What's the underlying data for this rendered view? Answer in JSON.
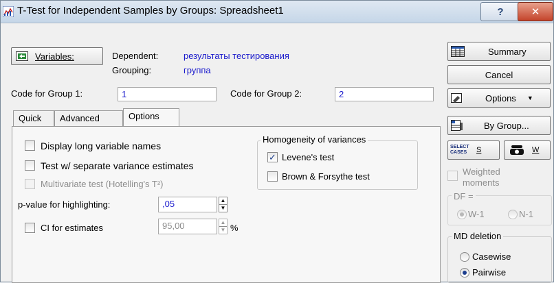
{
  "window": {
    "title": "T-Test for Independent Samples by Groups: Spreadsheet1"
  },
  "titlebar": {
    "help_glyph": "?",
    "close_glyph": "✕"
  },
  "variables": {
    "button_label": "Variables:",
    "dependent_label": "Dependent:",
    "dependent_value": "результаты тестирования",
    "grouping_label": "Grouping:",
    "grouping_value": "группа"
  },
  "codes": {
    "group1_label": "Code for Group 1:",
    "group1_value": "1",
    "group2_label": "Code for Group 2:",
    "group2_value": "2"
  },
  "tabs": [
    {
      "label": "Quick",
      "active": false
    },
    {
      "label": "Advanced",
      "active": false
    },
    {
      "label": "Options",
      "active": true
    }
  ],
  "options": {
    "long_names": {
      "label": "Display long variable names",
      "checked": false
    },
    "separate_variance": {
      "label": "Test w/ separate variance estimates",
      "checked": false
    },
    "multivariate": {
      "label": "Multivariate test (Hotelling's T²)",
      "checked": false,
      "disabled": true
    },
    "pvalue_label": "p-value for highlighting:",
    "pvalue_value": ",05",
    "ci": {
      "label": "CI for estimates",
      "checked": false,
      "value": "95,00",
      "unit": "%"
    },
    "homogeneity": {
      "title": "Homogeneity of variances",
      "levene": {
        "label": "Levene's test",
        "checked": true
      },
      "brown_forsythe": {
        "label": "Brown & Forsythe test",
        "checked": false
      }
    }
  },
  "side": {
    "summary": "Summary",
    "cancel": "Cancel",
    "options": "Options",
    "bygroup": "By Group...",
    "select_cases_icon_text": "SELECT CASES",
    "s_label": "S",
    "w_label": "W",
    "weighted": "Weighted moments",
    "df_title": "DF =",
    "df_w": "W-1",
    "df_n": "N-1",
    "md_title": "MD deletion",
    "casewise": "Casewise",
    "pairwise": "Pairwise",
    "md_selected": "pairwise"
  },
  "colors": {
    "accent_blue": "#1a1acc",
    "close_red": "#c4442b"
  }
}
